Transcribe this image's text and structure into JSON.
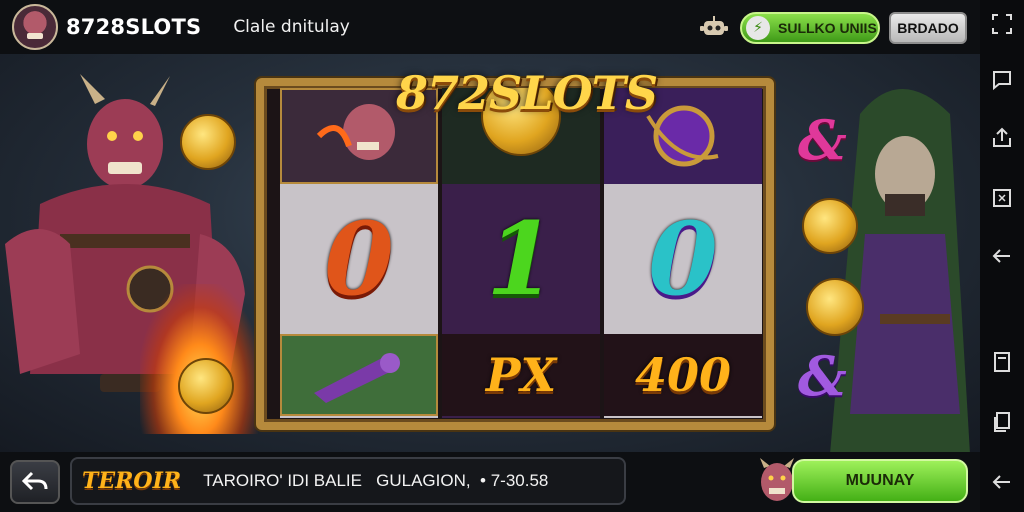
{
  "header": {
    "brand": "8728SLOTS",
    "subtitle": "Clale dnitulay",
    "balance_label": "SULLKO UNIIS",
    "balance_icon": "lightning-coin-icon",
    "account_button": "BRDADO"
  },
  "game": {
    "logo": "872SLOTS",
    "reels": [
      {
        "top": "demon-portrait-symbol",
        "middle": "0",
        "middle_color": "#e0551a",
        "bottom": "purple-club-symbol"
      },
      {
        "top": "green-arrow-coin-symbol",
        "middle": "1",
        "middle_color": "#4cd61e",
        "bottom": "PX"
      },
      {
        "top": "purple-ring-symbol",
        "middle": "0",
        "middle_color": "#2ac2c8",
        "bottom": "400"
      }
    ],
    "accent_color": "#b68a3c"
  },
  "footer": {
    "back_icon": "undo-arrow-icon",
    "ticker_tag": "TEROIR",
    "ticker_text": "TAROIRO' IDI BALIE   GULAGION,  • 7-30.58",
    "play_button": "MUUNAY"
  },
  "sidebar": {
    "icons": [
      "expand-icon",
      "message-icon",
      "share-icon",
      "crop-icon",
      "back-icon",
      "tab-icon",
      "copy-icon",
      "undo-icon"
    ]
  }
}
